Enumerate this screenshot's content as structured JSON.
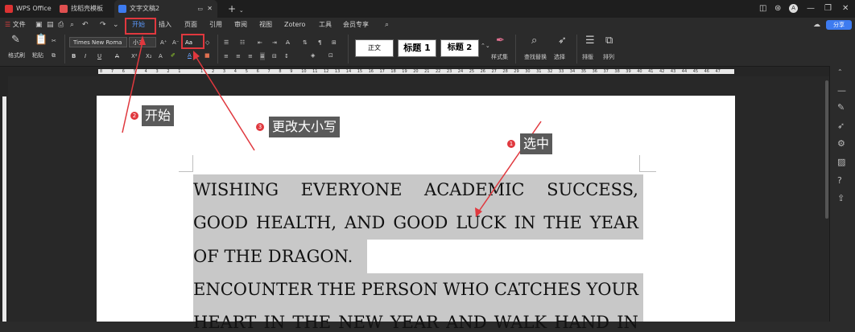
{
  "tabs": {
    "wps": "WPS Office",
    "template": "找稻壳模板",
    "doc": "文字文稿2",
    "new_tab": "+"
  },
  "menu": {
    "file": "文件",
    "items": [
      "开始",
      "插入",
      "页面",
      "引用",
      "审阅",
      "视图",
      "Zotero",
      "工具",
      "会员专享"
    ],
    "share": "分享"
  },
  "ribbon": {
    "format_painter": "格式刷",
    "paste": "粘贴",
    "font_name": "Times New Roma",
    "font_size": "小三",
    "style_normal": "正文",
    "style_h1": "标题 1",
    "style_h2": "标题 2",
    "styles_set": "样式集",
    "find_replace": "查找替换",
    "select": "选择",
    "layout": "排版",
    "arrange": "排列",
    "case_button": "Aa"
  },
  "ruler": {
    "ticks": [
      "8",
      "7",
      "6",
      "5",
      "4",
      "3",
      "2",
      "1",
      "",
      "1",
      "2",
      "3",
      "4",
      "5",
      "6",
      "7",
      "8",
      "9",
      "10",
      "11",
      "12",
      "13",
      "14",
      "15",
      "16",
      "17",
      "18",
      "19",
      "20",
      "21",
      "22",
      "23",
      "24",
      "25",
      "26",
      "27",
      "28",
      "29",
      "30",
      "31",
      "32",
      "33",
      "34",
      "35",
      "36",
      "37",
      "38",
      "39",
      "40",
      "41",
      "42",
      "43",
      "44",
      "45",
      "46",
      "47"
    ]
  },
  "document": {
    "line1": [
      "WISHING",
      "EVERYONE",
      "ACADEMIC",
      "SUCCESS,"
    ],
    "line2": [
      "GOOD",
      "HEALTH,",
      "AND",
      "GOOD",
      "LUCK",
      "IN",
      "THE",
      "YEAR"
    ],
    "line3": "OF THE DRAGON.",
    "line4": [
      "ENCOUNTER",
      "THE",
      "PERSON",
      "WHO",
      "CATCHES",
      "YOUR"
    ],
    "line5": [
      "HEART",
      "IN",
      "THE",
      "NEW",
      "YEAR",
      "AND",
      "WALK",
      "HAND",
      "IN"
    ]
  },
  "annotations": {
    "step1": {
      "num": "1",
      "label": "选中"
    },
    "step2": {
      "num": "2",
      "label": "开始"
    },
    "step3": {
      "num": "3",
      "label": "更改大小写"
    }
  },
  "colors": {
    "accent": "#5b9bff",
    "annotation_red": "#e0383e",
    "selection": "#c8c8c8"
  }
}
